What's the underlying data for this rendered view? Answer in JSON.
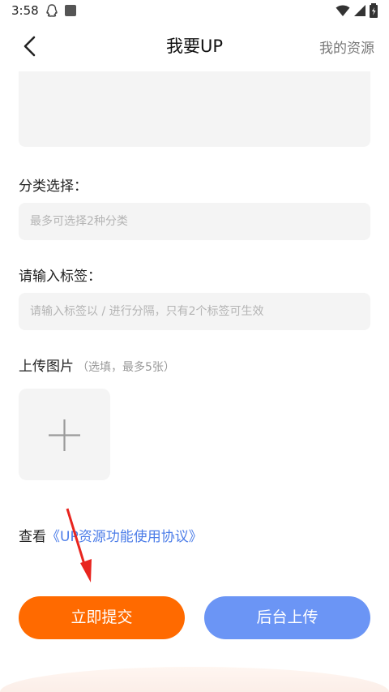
{
  "status_bar": {
    "time": "3:58"
  },
  "header": {
    "title": "我要UP",
    "my_resources": "我的资源"
  },
  "category": {
    "label": "分类选择：",
    "placeholder": "最多可选择2种分类"
  },
  "tags": {
    "label": "请输入标签：",
    "placeholder": "请输入标签以 / 进行分隔，只有2个标签可生效"
  },
  "images": {
    "label": "上传图片",
    "hint": "（选填，最多5张）"
  },
  "agreement": {
    "prefix": "查看",
    "link": "《UP资源功能使用协议》"
  },
  "buttons": {
    "submit": "立即提交",
    "background_upload": "后台上传"
  },
  "colors": {
    "accent_orange": "#ff6a00",
    "accent_blue": "#6b95f5",
    "link_blue": "#4c7de8"
  }
}
